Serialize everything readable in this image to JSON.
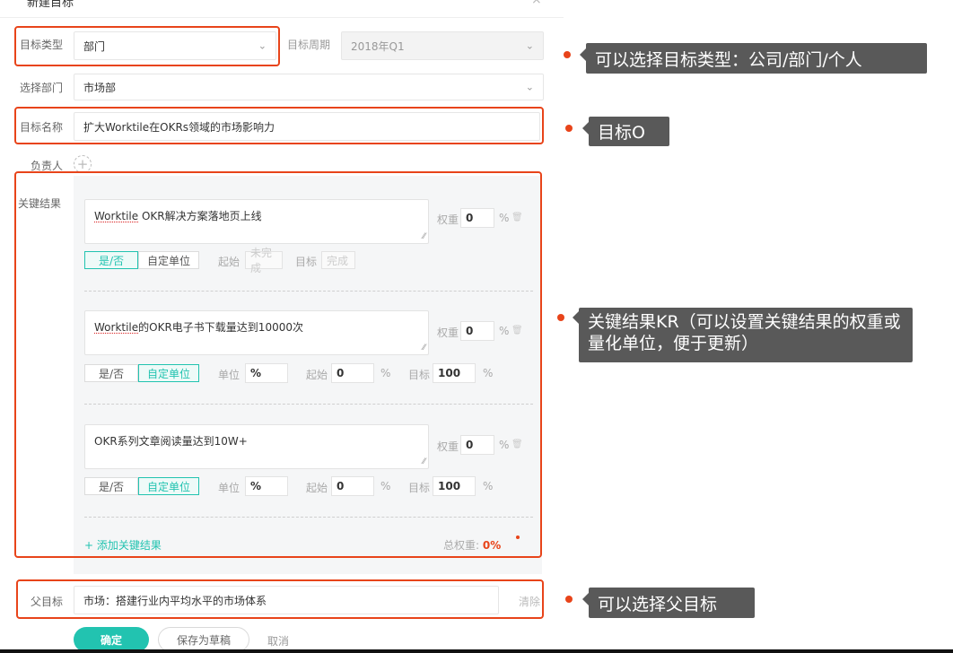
{
  "dialog": {
    "title": "新建目标",
    "close": "×"
  },
  "form": {
    "type_label": "目标类型",
    "type_value": "部门",
    "cycle_label": "目标周期",
    "cycle_value": "2018年Q1",
    "dept_label": "选择部门",
    "dept_value": "市场部",
    "name_label": "目标名称",
    "name_value": "扩大Worktile在OKRs领域的市场影响力",
    "owner_label": "负责人",
    "kr_label": "关键结果",
    "parent_label": "父目标",
    "parent_value": "市场：搭建行业内平均水平的市场体系",
    "parent_clear": "清除"
  },
  "key_results": [
    {
      "text_prefix": "Worktile",
      "text_suffix": " OKR解决方案落地页上线",
      "weight_label": "权重",
      "weight": "0",
      "pct": "%",
      "toggle_bool": "是/否",
      "toggle_unit": "自定单位",
      "active": "bool",
      "start_label": "起始",
      "start_value": "未完成",
      "target_label": "目标",
      "target_value": "完成"
    },
    {
      "text_prefix": "Worktile",
      "text_suffix": "的OKR电子书下载量达到10000次",
      "weight_label": "权重",
      "weight": "0",
      "pct": "%",
      "toggle_bool": "是/否",
      "toggle_unit": "自定单位",
      "active": "unit",
      "unit_label": "单位",
      "unit_value": "%",
      "start_label": "起始",
      "start_value": "0",
      "start_pct": "%",
      "target_label": "目标",
      "target_value": "100",
      "target_pct": "%"
    },
    {
      "text_prefix": "",
      "text_suffix": "OKR系列文章阅读量达到10W+",
      "weight_label": "权重",
      "weight": "0",
      "pct": "%",
      "toggle_bool": "是/否",
      "toggle_unit": "自定单位",
      "active": "unit",
      "unit_label": "单位",
      "unit_value": "%",
      "start_label": "起始",
      "start_value": "0",
      "start_pct": "%",
      "target_label": "目标",
      "target_value": "100",
      "target_pct": "%"
    }
  ],
  "kr_footer": {
    "add": "+ 添加关键结果",
    "total_label": "总权重: ",
    "total_value": "0%"
  },
  "actions": {
    "confirm": "确定",
    "draft": "保存为草稿",
    "cancel": "取消"
  },
  "callouts": {
    "type": "可以选择目标类型：公司/部门/个人",
    "objective": "目标O",
    "kr": "关键结果KR（可以设置关键结果的权重或量化单位，便于更新）",
    "parent": "可以选择父目标"
  },
  "colors": {
    "accent": "#22c3b0",
    "annotation": "#e8441a",
    "callout_bg": "#595959"
  }
}
